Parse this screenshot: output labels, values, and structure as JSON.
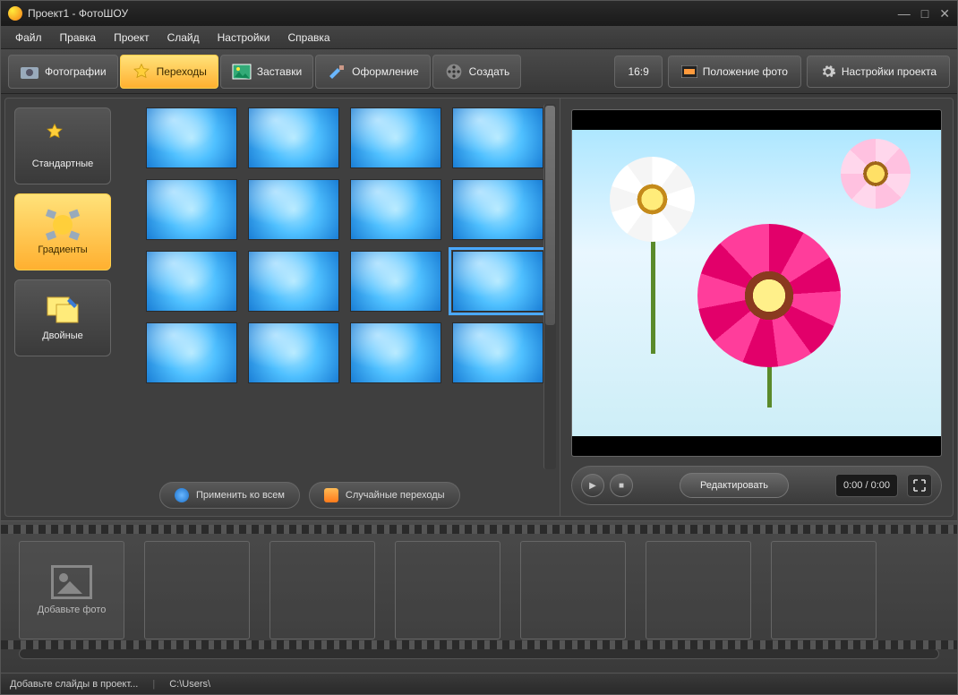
{
  "title": "Проект1 - ФотоШОУ",
  "menus": [
    "Файл",
    "Правка",
    "Проект",
    "Слайд",
    "Настройки",
    "Справка"
  ],
  "tabs": [
    {
      "label": "Фотографии",
      "icon": "camera"
    },
    {
      "label": "Переходы",
      "icon": "star",
      "active": true
    },
    {
      "label": "Заставки",
      "icon": "picture"
    },
    {
      "label": "Оформление",
      "icon": "brush"
    },
    {
      "label": "Создать",
      "icon": "reel"
    }
  ],
  "aspect": "16:9",
  "right_buttons": {
    "position": "Положение фото",
    "settings": "Настройки проекта"
  },
  "categories": [
    {
      "label": "Стандартные",
      "icon": "star"
    },
    {
      "label": "Градиенты",
      "icon": "gradient",
      "active": true
    },
    {
      "label": "Двойные",
      "icon": "double"
    }
  ],
  "thumbs_count": 16,
  "selected_thumb_index": 11,
  "actions": {
    "apply_all": "Применить ко всем",
    "random": "Случайные переходы"
  },
  "player": {
    "edit": "Редактировать",
    "time": "0:00 / 0:00"
  },
  "timeline": {
    "add_label": "Добавьте фото",
    "empty_slots": 6
  },
  "status": {
    "hint": "Добавьте слайды в проект...",
    "path": "C:\\Users\\"
  }
}
